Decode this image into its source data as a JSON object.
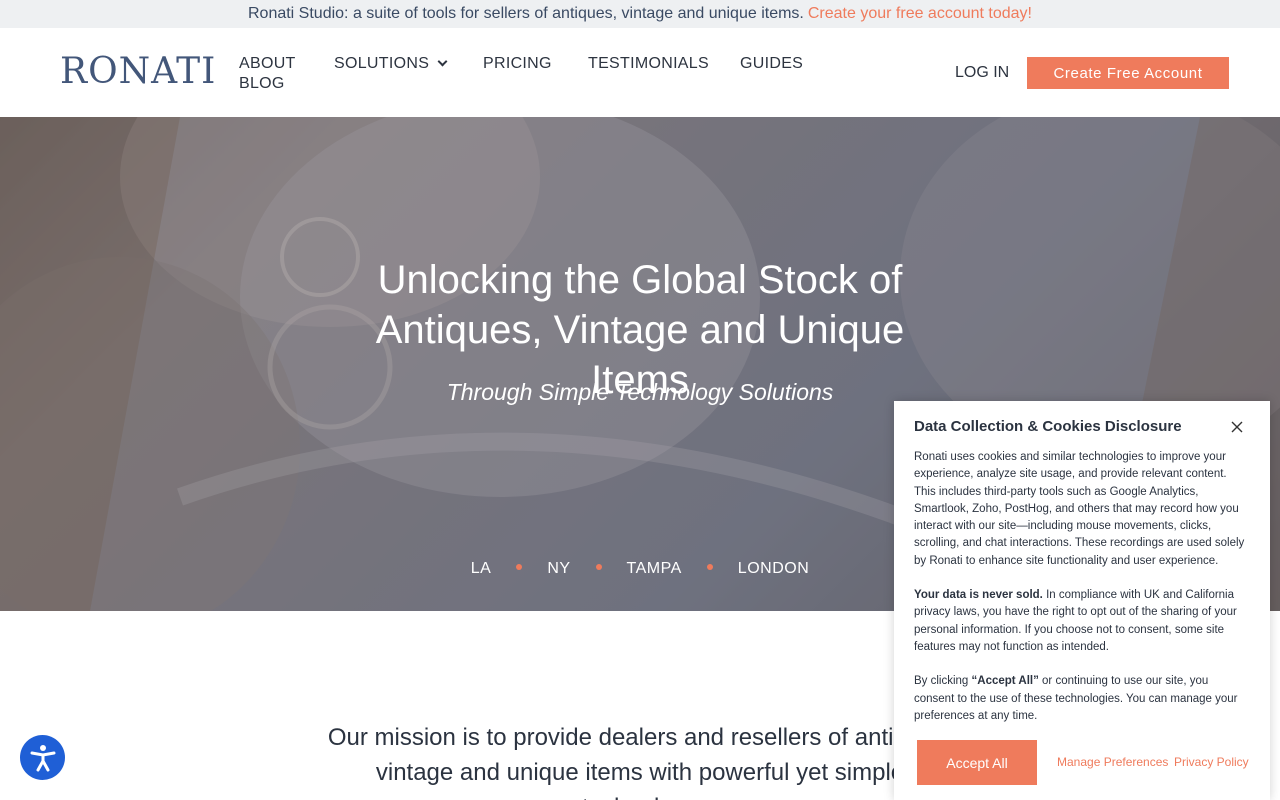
{
  "announcement": {
    "text": "Ronati Studio: a suite of tools for sellers of antiques, vintage and unique items.",
    "cta": "Create your free account today!"
  },
  "header": {
    "logo": "RONATI",
    "nav": [
      "ABOUT",
      "SOLUTIONS",
      "PRICING",
      "TESTIMONIALS",
      "GUIDES",
      "BLOG"
    ],
    "login": "LOG IN",
    "create_button": "Create Free Account"
  },
  "hero": {
    "title": "Unlocking the Global Stock of Antiques, Vintage and Unique Items",
    "subtitle": "Through Simple Technology Solutions",
    "cities": [
      "LA",
      "NY",
      "TAMPA",
      "LONDON"
    ]
  },
  "mission": {
    "text": "Our mission is to provide dealers and resellers of antiques, vintage and unique items with powerful yet simple technology"
  },
  "cookie": {
    "title": "Data Collection & Cookies Disclosure",
    "para1": "Ronati uses cookies and similar technologies to improve your experience, analyze site usage, and provide relevant content. This includes third-party tools such as Google Analytics, Smartlook, Zoho, PostHog, and others that may record how you interact with our site—including mouse movements, clicks, scrolling, and chat interactions. These recordings are used solely by Ronati to enhance site functionality and user experience.",
    "para2_bold": "Your data is never sold.",
    "para2_rest": " In compliance with UK and California privacy laws, you have the right to opt out of the sharing of your personal information. If you choose not to consent, some site features may not function as intended.",
    "para3_pre": "By clicking ",
    "para3_bold": "“Accept All”",
    "para3_rest": " or continuing to use our site, you consent to the use of these technologies. You can manage your preferences at any time.",
    "accept": "Accept All",
    "manage": "Manage Preferences",
    "privacy": "Privacy Policy"
  },
  "icons": {
    "accessibility": "accessibility-icon",
    "close": "close-icon",
    "dropdown": "chevron-down-icon"
  },
  "colors": {
    "accent": "#ef7b5c",
    "logo": "#43577a",
    "accessibility": "#1f5fd6"
  }
}
